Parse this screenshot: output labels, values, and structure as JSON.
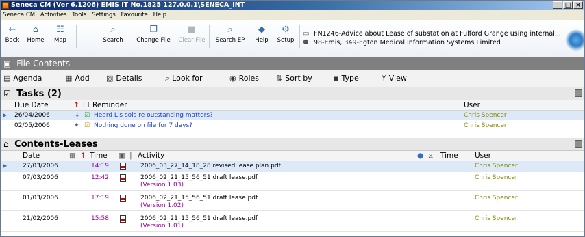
{
  "window": {
    "title": "Seneca CM (Ver 6.1206) EMIS IT No.1825 127.0.0.1\\SENECA_INT",
    "min": "_",
    "restore": "□",
    "close": "×"
  },
  "menu": [
    "Seneca CM",
    "Activities",
    "Tools",
    "Settings",
    "Favourite",
    "Help"
  ],
  "toolbar": {
    "buttons": [
      {
        "label": "Back",
        "icon": "←"
      },
      {
        "label": "Home",
        "icon": "⌂"
      },
      {
        "label": "Map",
        "icon": "☷"
      },
      {
        "label": "Search",
        "icon": "⌕"
      },
      {
        "label": "Change File",
        "icon": "❐"
      },
      {
        "label": "Clear File",
        "icon": "■"
      },
      {
        "label": "Search EP",
        "icon": "⌕"
      },
      {
        "label": "Help",
        "icon": "◆"
      },
      {
        "label": "Setup",
        "icon": "⚙"
      }
    ],
    "file_line1": "FN1246-Advice about Lease of substation at Fulford Grange using internal...",
    "file_line2": "98-Emis, 349-Egton Medical Information Systems Limited",
    "folder_icon": "▭",
    "client_icon": "⚉"
  },
  "file_contents": {
    "title": "File Contents",
    "icon": "▣"
  },
  "actions": [
    {
      "label": "Agenda",
      "icon": "▤"
    },
    {
      "label": "Add",
      "icon": "▦"
    },
    {
      "label": "Details",
      "icon": "▧"
    },
    {
      "label": "Look for",
      "icon": "⌕"
    },
    {
      "label": "Roles",
      "icon": "◉"
    },
    {
      "label": "Sort by",
      "icon": "⇅"
    },
    {
      "label": "Type",
      "icon": "▪"
    },
    {
      "label": "View",
      "icon": "Y"
    }
  ],
  "tasks": {
    "title": "Tasks (2)",
    "icon": "☑",
    "columns": {
      "due": "Due Date",
      "reminder": "Reminder",
      "user": "User"
    },
    "rows": [
      {
        "date": "26/04/2006",
        "text": "Heard L's sols re outstanding matters?",
        "user": "Chris Spencer"
      },
      {
        "date": "02/05/2006",
        "text": "Nothing done on file for 7 days?",
        "user": "Chris Spencer"
      }
    ]
  },
  "contents": {
    "title": "Contents-Leases",
    "icon": "⌂",
    "columns": {
      "date": "Date",
      "time": "Time",
      "activity": "Activity",
      "time2": "Time",
      "user": "User"
    },
    "rows": [
      {
        "date": "27/03/2006",
        "time": "14:19",
        "activity": "2006_03_27_14_18_28 revised lease plan.pdf",
        "version": "",
        "user": "Chris Spencer"
      },
      {
        "date": "07/03/2006",
        "time": "12:42",
        "activity": "2006_02_21_15_56_51 draft lease.pdf",
        "version": "(Version 1.03)",
        "user": "Chris Spencer"
      },
      {
        "date": "01/03/2006",
        "time": "17:19",
        "activity": "2006_02_21_15_56_51 draft lease.pdf",
        "version": "(Version 1.02)",
        "user": "Chris Spencer"
      },
      {
        "date": "21/02/2006",
        "time": "15:58",
        "activity": "2006_02_21_15_56_51 draft lease.pdf",
        "version": "(Version 1.01)",
        "user": "Chris Spencer"
      }
    ]
  }
}
